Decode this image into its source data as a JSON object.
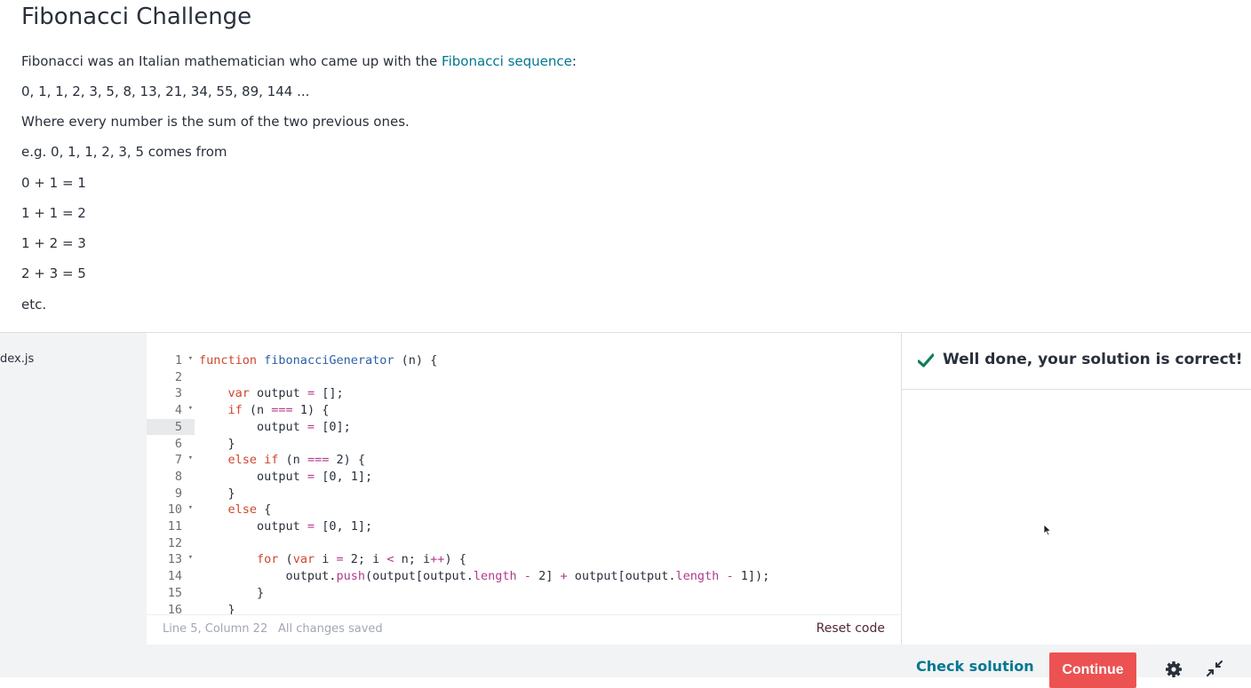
{
  "instructions": {
    "title": "Fibonacci Challenge",
    "intro_prefix": "Fibonacci was an Italian mathematician who came up with the ",
    "intro_link": "Fibonacci sequence",
    "intro_suffix": ":",
    "sequence": "0, 1, 1, 2, 3, 5, 8, 13, 21, 34, 55, 89, 144 ...",
    "rule": "Where every number is the sum of the two previous ones.",
    "example": "e.g. 0, 1, 1, 2, 3, 5 comes from",
    "steps": [
      "0 + 1 = 1",
      "1 + 1 = 2",
      "1 + 2 = 3",
      "2 + 3 = 5",
      "etc."
    ]
  },
  "files": {
    "active_file": "dex.js"
  },
  "editor": {
    "active_line": 5,
    "lines": [
      {
        "n": "1",
        "fold": true
      },
      {
        "n": "2",
        "fold": false
      },
      {
        "n": "3",
        "fold": false
      },
      {
        "n": "4",
        "fold": true
      },
      {
        "n": "5",
        "fold": false
      },
      {
        "n": "6",
        "fold": false
      },
      {
        "n": "7",
        "fold": true
      },
      {
        "n": "8",
        "fold": false
      },
      {
        "n": "9",
        "fold": false
      },
      {
        "n": "10",
        "fold": true
      },
      {
        "n": "11",
        "fold": false
      },
      {
        "n": "12",
        "fold": false
      },
      {
        "n": "13",
        "fold": true
      },
      {
        "n": "14",
        "fold": false
      },
      {
        "n": "15",
        "fold": false
      },
      {
        "n": "16",
        "fold": false
      }
    ]
  },
  "status": {
    "position": "Line 5, Column 22",
    "saved": "All changes saved",
    "reset_label": "Reset code"
  },
  "result": {
    "message": "Well done, your solution is correct!",
    "status_color": "#0f7c5a"
  },
  "footer": {
    "check_label": "Check solution",
    "continue_label": "Continue",
    "accent": "#ec5252"
  }
}
